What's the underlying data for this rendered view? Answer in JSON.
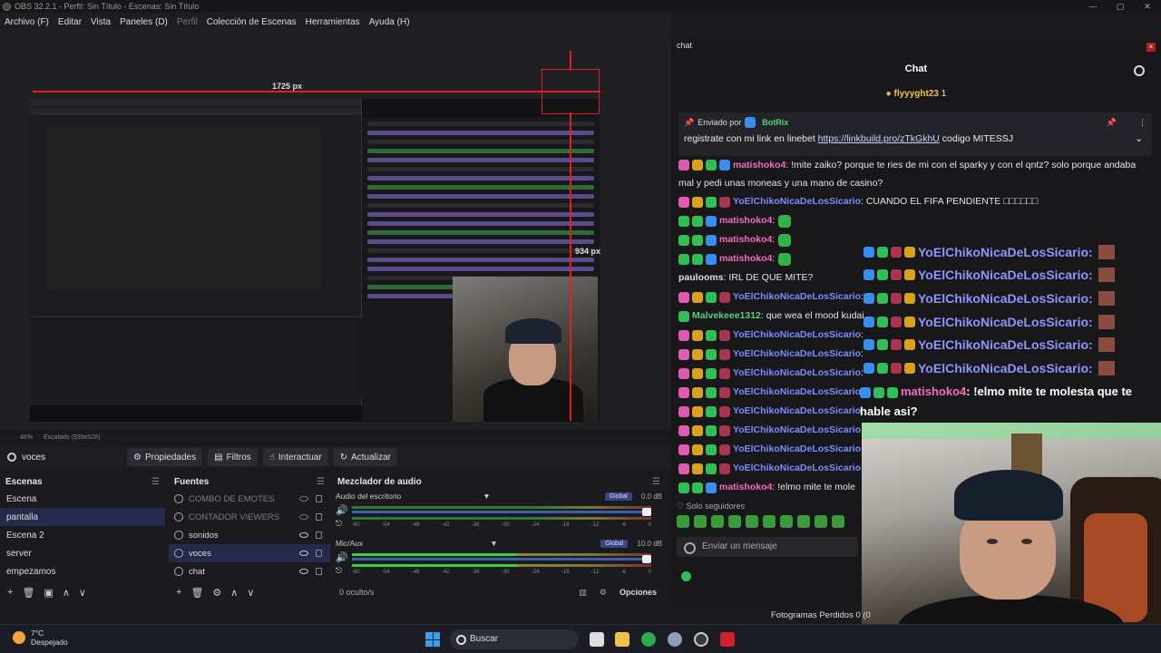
{
  "window": {
    "title": "OBS 32.2.1 - Perfil: Sin Título - Escenas: Sin Título",
    "controls": [
      "—",
      "▢",
      "✕"
    ]
  },
  "menu": {
    "items": [
      "Archivo (F)",
      "Editar",
      "Vista",
      "Paneles (D)",
      "Perfil",
      "Colección de Escenas",
      "Herramientas",
      "Ayuda (H)"
    ]
  },
  "preview": {
    "width_label": "1725 px",
    "height_label": "934 px",
    "zoom": "48%",
    "scaled": "Escalado (939x528)"
  },
  "toolbar": {
    "source_name": "voces",
    "properties": "Propiedades",
    "filters": "Filtros",
    "interact": "Interactuar",
    "refresh": "Actualizar"
  },
  "scenes": {
    "title": "Escenas",
    "items": [
      "Escena",
      "pantalla",
      "Escena 2",
      "server",
      "empezamos"
    ],
    "selected": 1
  },
  "sources": {
    "title": "Fuentes",
    "items": [
      "COMBO DE EMOTES",
      "CONTADOR VIEWERS",
      "sonidos",
      "voces",
      "chat"
    ],
    "selected": 3
  },
  "mixer": {
    "title": "Mezclador de audio",
    "channels": [
      {
        "name": "Audio del escritorio",
        "mode": "Global",
        "db": "0.0 dB",
        "level": 0.0
      },
      {
        "name": "Mic/Aux",
        "mode": "Global",
        "db": "10.0 dB",
        "level": 0.55
      }
    ],
    "ticks": [
      "-60",
      "-54",
      "-48",
      "-42",
      "-36",
      "-30",
      "-24",
      "-18",
      "-12",
      "-6",
      "0"
    ],
    "hidden": "0 oculto/s",
    "options": "Opciones"
  },
  "chat": {
    "tab": "chat",
    "title": "Chat",
    "hype_user": "flyyyght23",
    "hype_count": "1",
    "pinned_by_label": "Enviado por",
    "pinned_by": "BotRix",
    "pinned_text": "registrate con mi link en linebet ",
    "pinned_link": "https://linkbuild.pro/zTkGkhU",
    "pinned_after": " codigo MITESSJ",
    "messages": [
      {
        "user": "matishoko4",
        "text": ": !mite zaiko? porque te ries de mi con el sparky y con el qntz? solo porque andaba mal y pedi unas moneas y una mano de casino?"
      },
      {
        "user": "YoElChikoNicaDeLosSicario",
        "text": ": CUANDO EL FIFA PENDIENTE □□□□□□"
      },
      {
        "user": "matishoko4",
        "text": ":"
      },
      {
        "user": "matishoko4",
        "text": ":"
      },
      {
        "user": "matishoko4",
        "text": ":"
      },
      {
        "user": "paulooms",
        "text": ": IRL DE QUE MITE?"
      },
      {
        "user": "YoElChikoNicaDeLosSicario",
        "text": ":"
      },
      {
        "user": "Malvekeee1312",
        "text": ": que wea el mood kudai"
      },
      {
        "user": "YoElChikoNicaDeLosSicario",
        "text": ":"
      },
      {
        "user": "YoElChikoNicaDeLosSicario",
        "text": ":"
      },
      {
        "user": "YoElChikoNicaDeLosSicario",
        "text": ":"
      },
      {
        "user": "YoElChikoNicaDeLosSicario",
        "text": ":"
      },
      {
        "user": "YoElChikoNicaDeLosSicario",
        "text": ":"
      },
      {
        "user": "YoElChikoNicaDeLosSicario",
        "text": ":"
      },
      {
        "user": "YoElChikoNicaDeLosSicario",
        "text": ":"
      },
      {
        "user": "YoElChikoNicaDeLosSicario",
        "text": ":"
      },
      {
        "user": "matishoko4",
        "text": ": !elmo mite te mole"
      }
    ],
    "overlay_user": "YoElChikoNicaDeLosSicario",
    "overlay_suffix": ":",
    "overlay_mati_user": "matishoko4",
    "overlay_mati_text": ": !elmo mite te molesta que te hable asi?",
    "followers_only": "Solo seguidores",
    "input_placeholder": "Enviar un mensaje"
  },
  "status": {
    "frames": "Fotogramas Perdidos 0 (0"
  },
  "taskbar": {
    "temp": "7°C",
    "weather": "Despejado",
    "search": "Buscar"
  },
  "colors": {
    "accent": "#3a4585",
    "pink": "#f36cc0",
    "blue": "#7b8cff",
    "green": "#59d07a"
  }
}
